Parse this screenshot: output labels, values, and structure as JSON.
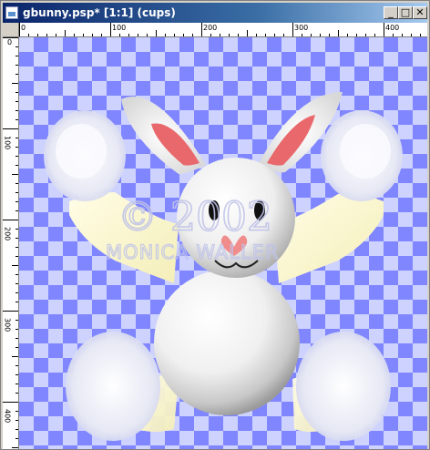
{
  "window": {
    "title": "gbunny.psp* [1:1] (cups)",
    "controls": {
      "minimize": "_",
      "maximize": "□",
      "close": "✕"
    }
  },
  "rulers": {
    "top_labels": [
      "0",
      "100",
      "200",
      "300",
      "400"
    ],
    "left_labels": [
      "0",
      "100",
      "200",
      "300",
      "400"
    ]
  },
  "watermark": {
    "year": "© 2002",
    "author": "MONICA WALLER"
  },
  "colors": {
    "checker_dark": "#7f86ff",
    "checker_light": "#cdd2ff",
    "bunny_white": "#f4f4f4",
    "arm_yellow": "#fffbd2",
    "ear_pink": "#e9686c"
  }
}
